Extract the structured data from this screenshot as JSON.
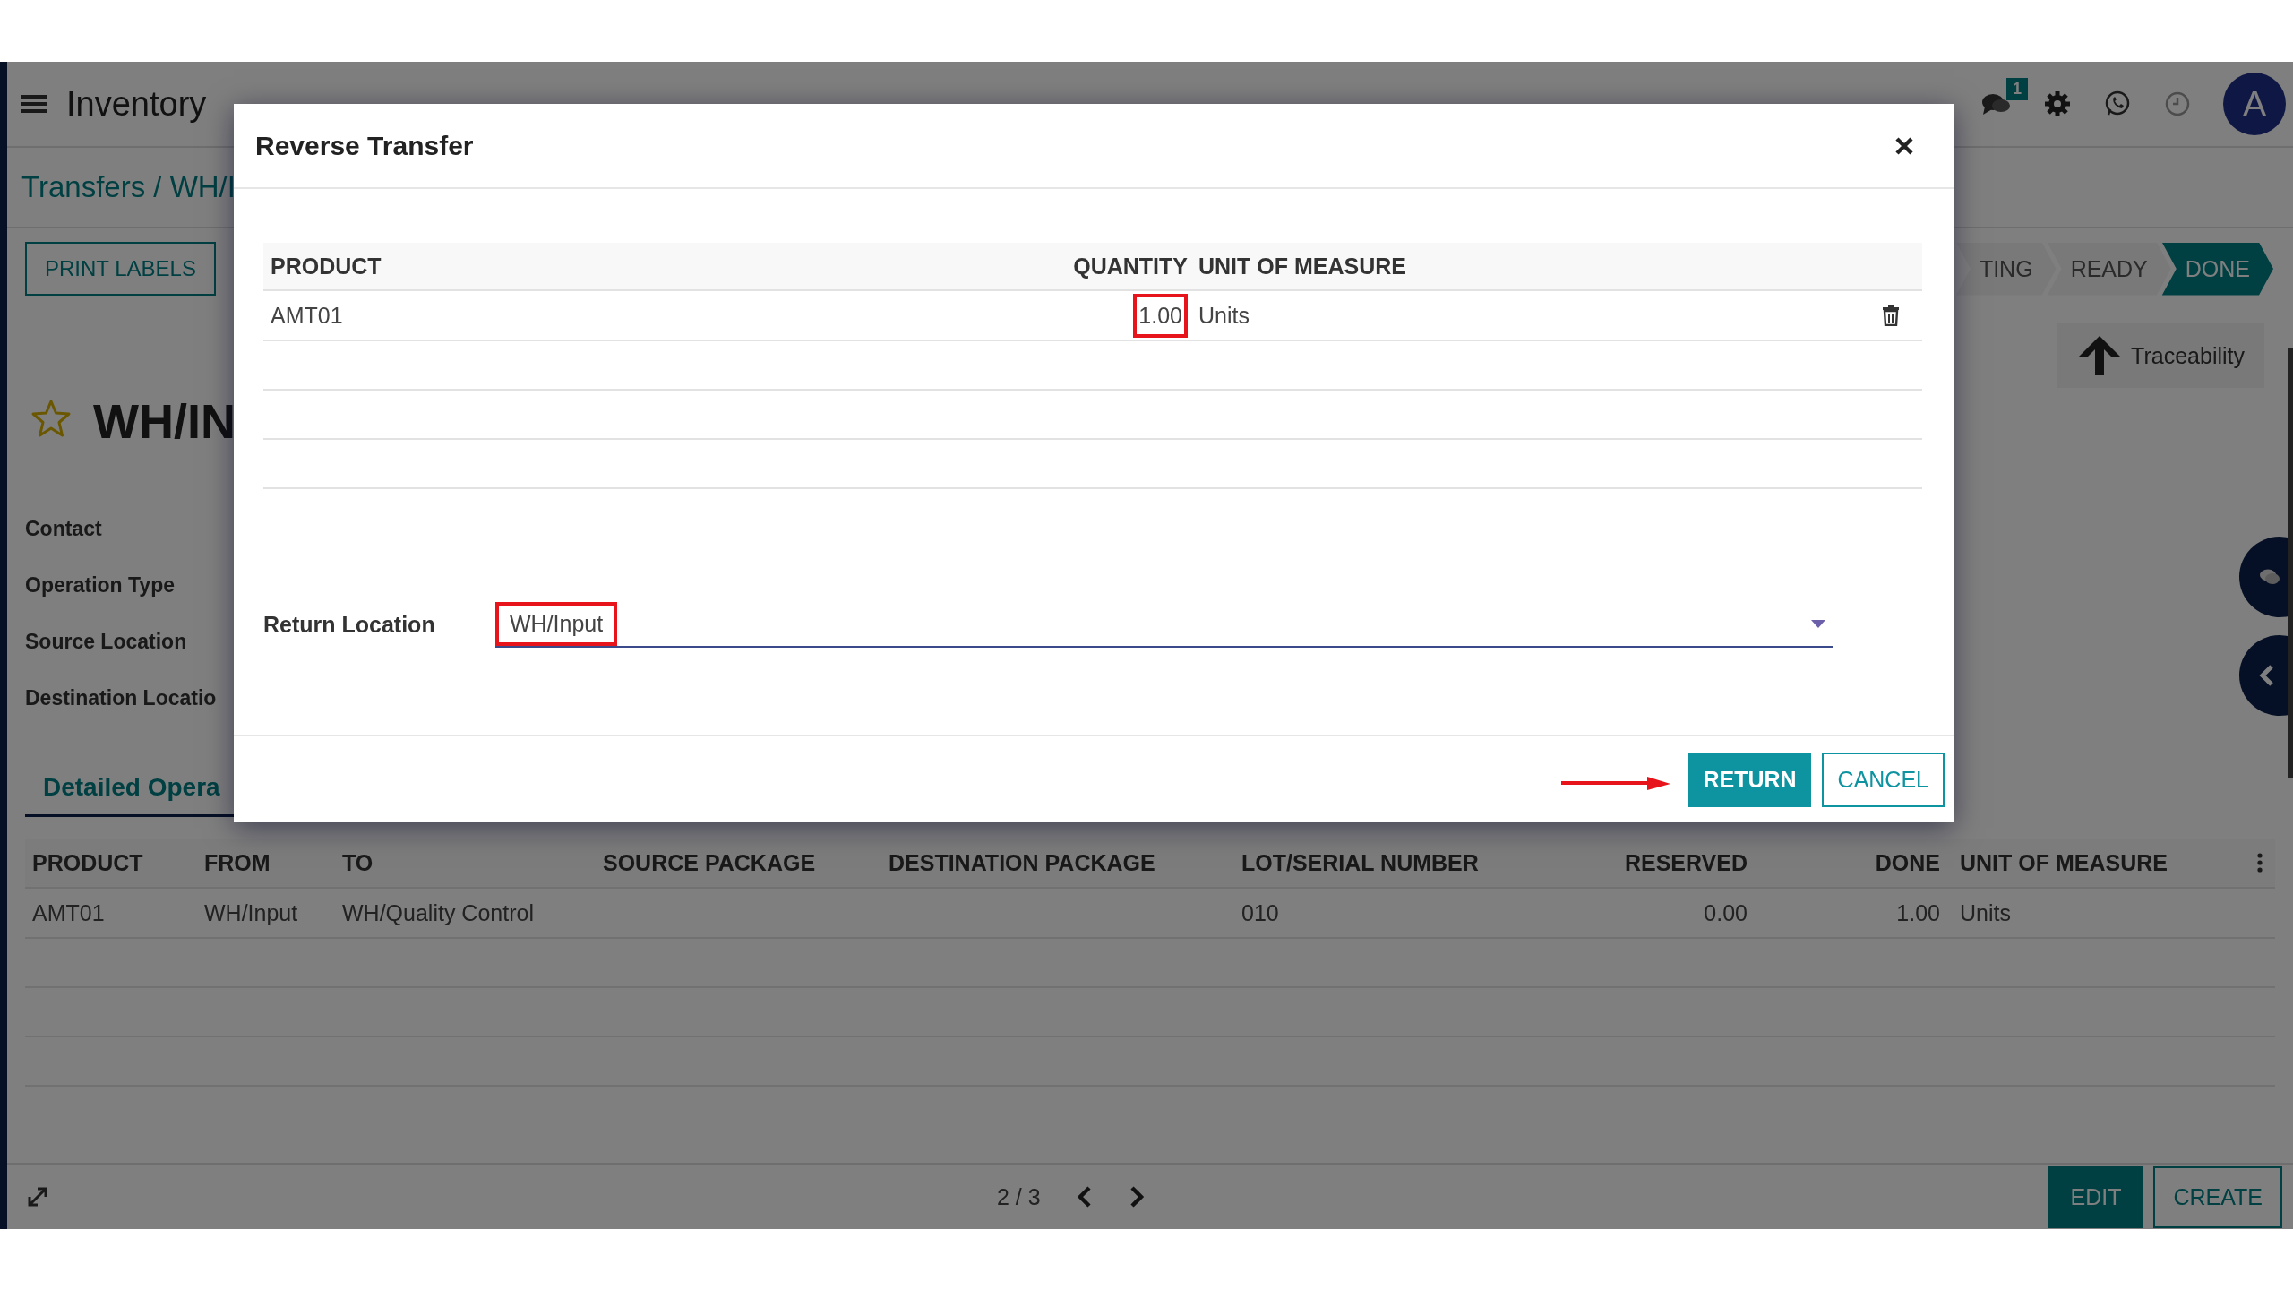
{
  "app": {
    "title": "Inventory",
    "notification_count": "1",
    "avatar": "A"
  },
  "breadcrumb": "Transfers / WH/I",
  "actions": [
    "PRINT LABELS"
  ],
  "stages": [
    {
      "label": "TING",
      "selected": false
    },
    {
      "label": "READY",
      "selected": false
    },
    {
      "label": "DONE",
      "selected": true
    }
  ],
  "smart_button": "Traceability",
  "record": {
    "name": "WH/IN",
    "starred": false
  },
  "fields": [
    "Contact",
    "Operation Type",
    "Source Location",
    "Destination Locatio"
  ],
  "tabs": [
    {
      "label": "Detailed Opera",
      "selected": true
    }
  ],
  "operations": {
    "columns": [
      "PRODUCT",
      "FROM",
      "TO",
      "SOURCE PACKAGE",
      "DESTINATION PACKAGE",
      "LOT/SERIAL NUMBER",
      "RESERVED",
      "DONE",
      "UNIT OF MEASURE"
    ],
    "rows": [
      [
        "AMT01",
        "WH/Input",
        "WH/Quality Control",
        "",
        "",
        "010",
        "0.00",
        "1.00",
        "Units"
      ]
    ]
  },
  "pager": "2 / 3",
  "footer_buttons": [
    "EDIT",
    "CREATE"
  ],
  "dialog": {
    "title": "Reverse Transfer",
    "columns": [
      "PRODUCT",
      "QUANTITY",
      "UNIT OF MEASURE"
    ],
    "rows": [
      {
        "product": "AMT01",
        "quantity": "1.00",
        "unit": "Units"
      }
    ],
    "return_location_label": "Return Location",
    "return_location": "WH/Input",
    "buttons": [
      {
        "label": "RETURN",
        "kind": "primary"
      },
      {
        "label": "CANCEL",
        "kind": "secondary"
      }
    ]
  }
}
